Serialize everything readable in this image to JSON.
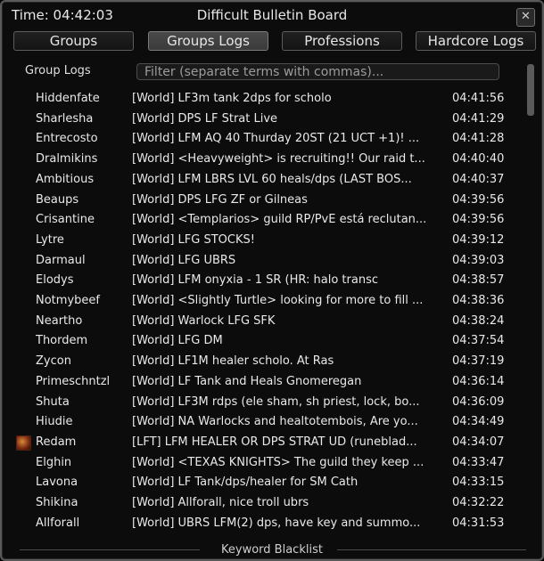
{
  "window": {
    "time_text": "Time: 04:42:03",
    "title": "Difficult Bulletin Board",
    "close_glyph": "✕"
  },
  "tabs": [
    {
      "label": "Groups",
      "active": false
    },
    {
      "label": "Groups Logs",
      "active": true
    },
    {
      "label": "Professions",
      "active": false
    },
    {
      "label": "Hardcore Logs",
      "active": false
    }
  ],
  "group_logs": {
    "label": "Group Logs",
    "filter_placeholder": "Filter (separate terms with commas)..."
  },
  "rows": [
    {
      "name": "Hiddenfate",
      "message": "[World] LF3m tank 2dps for scholo",
      "time": "04:41:56"
    },
    {
      "name": "Sharlesha",
      "message": "[World] DPS LF Strat Live",
      "time": "04:41:29"
    },
    {
      "name": "Entrecosto",
      "message": "[World] LFM AQ 40 Thurday 20ST (21 UCT +1)! ...",
      "time": "04:41:28"
    },
    {
      "name": "Dralmikins",
      "message": "[World] <Heavyweight> is recruiting!! Our raid t...",
      "time": "04:40:40"
    },
    {
      "name": "Ambitious",
      "message": "[World] LFM LBRS LVL 60 heals/dps (LAST BOS...",
      "time": "04:40:37"
    },
    {
      "name": "Beaups",
      "message": "[World] DPS LFG ZF or Gilneas",
      "time": "04:39:56"
    },
    {
      "name": "Crisantine",
      "message": "[World] <Templarios> guild RP/PvE está reclutan...",
      "time": "04:39:56"
    },
    {
      "name": "Lytre",
      "message": "[World] LFG STOCKS!",
      "time": "04:39:12"
    },
    {
      "name": "Darmaul",
      "message": "[World] LFG UBRS",
      "time": "04:39:03"
    },
    {
      "name": "Elodys",
      "message": "[World] LFM onyxia - 1 SR (HR: halo transc",
      "time": "04:38:57"
    },
    {
      "name": "Notmybeef",
      "message": "[World] <Slightly Turtle> looking for more to fill ...",
      "time": "04:38:36"
    },
    {
      "name": "Neartho",
      "message": "[World] Warlock LFG SFK",
      "time": "04:38:24"
    },
    {
      "name": "Thordem",
      "message": "[World] LFG DM",
      "time": "04:37:54"
    },
    {
      "name": "Zycon",
      "message": "[World] LF1M healer scholo. At Ras",
      "time": "04:37:19"
    },
    {
      "name": "Primeschntzl",
      "message": "[World] LF Tank and Heals Gnomeregan",
      "time": "04:36:14"
    },
    {
      "name": "Shuta",
      "message": "[World] LF3M rdps (ele sham, sh priest, lock, bo...",
      "time": "04:36:09"
    },
    {
      "name": "Hiudie",
      "message": "[World] NA Warlocks and healtotembois, Are yo...",
      "time": "04:34:49"
    },
    {
      "name": "Redam",
      "message": "[LFT] LFM HEALER OR DPS STRAT UD (runeblad...",
      "time": "04:34:07",
      "icon": "class-portrait-icon"
    },
    {
      "name": "Elghin",
      "message": "[World] <TEXAS KNIGHTS> The guild they keep ...",
      "time": "04:33:47"
    },
    {
      "name": "Lavona",
      "message": "[World] LF Tank/dps/healer for SM Cath",
      "time": "04:33:15"
    },
    {
      "name": "Shikina",
      "message": "[World] Allforall, nice troll ubrs",
      "time": "04:32:22"
    },
    {
      "name": "Allforall",
      "message": "[World] UBRS LFM(2) dps, have key and summo...",
      "time": "04:31:53"
    }
  ],
  "scrollbar": {
    "position": 0.0
  },
  "footer": {
    "label": "Keyword Blacklist"
  }
}
